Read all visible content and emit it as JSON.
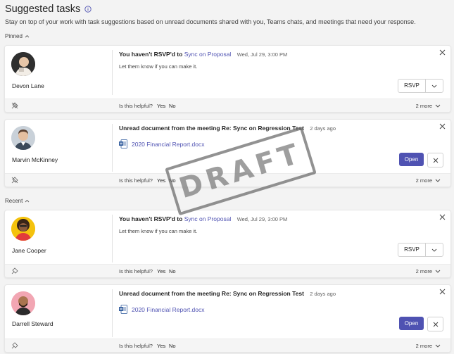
{
  "header": {
    "title": "Suggested tasks",
    "subtitle": "Stay on top of your work with task suggestions based on unread documents shared with you, Teams chats, and meetings that need your response."
  },
  "sections": {
    "pinned": "Pinned",
    "recent": "Recent"
  },
  "cards": [
    {
      "person": "Devon Lane",
      "headline_prefix": "You haven't RSVP'd to",
      "headline_link": "Sync on Proposal",
      "timestamp": "Wed, Jul 29, 3:00 PM",
      "message": "Let them know if you can make it.",
      "action": "RSVP",
      "helpful": "Is this helpful?",
      "yes": "Yes",
      "no": "No",
      "more": "2 more"
    },
    {
      "person": "Marvin McKinney",
      "headline": "Unread document from the meeting Re: Sync on Regression Test",
      "timestamp": "2 days ago",
      "document": "2020 Financial Report.docx",
      "action": "Open",
      "helpful": "Is this helpful?",
      "yes": "Yes",
      "no": "No",
      "more": "2 more"
    },
    {
      "person": "Jane Cooper",
      "headline_prefix": "You haven't RSVP'd to",
      "headline_link": "Sync on Proposal",
      "timestamp": "Wed, Jul 29, 3:00 PM",
      "message": "Let them know if you can make it.",
      "action": "RSVP",
      "helpful": "Is this helpful?",
      "yes": "Yes",
      "no": "No",
      "more": "2 more"
    },
    {
      "person": "Darrell Steward",
      "headline": "Unread document from the meeting Re: Sync on Regression Test",
      "timestamp": "2 days ago",
      "document": "2020 Financial Report.docx",
      "action": "Open",
      "helpful": "Is this helpful?",
      "yes": "Yes",
      "no": "No",
      "more": "2 more"
    }
  ],
  "watermark": "DRAFT",
  "colors": {
    "accent": "#4f52b2",
    "background": "#f3f3f3",
    "card": "#ffffff"
  }
}
